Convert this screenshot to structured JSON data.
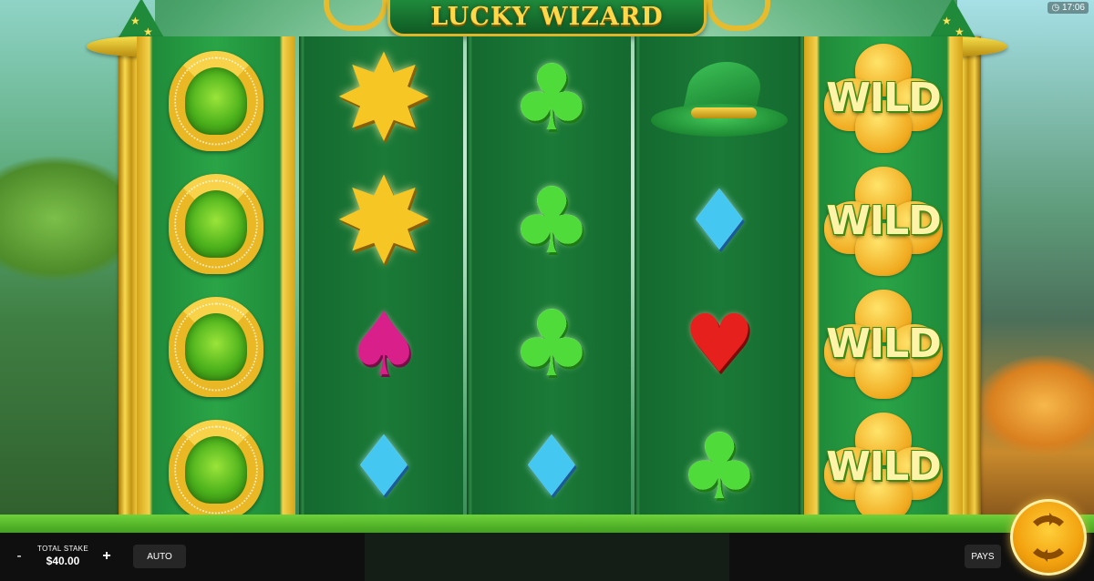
{
  "game": {
    "title": "LUCKY WIZARD",
    "clock": "17:06"
  },
  "reels": [
    {
      "name": "reel-1",
      "symbols": [
        "horseshoe",
        "horseshoe",
        "horseshoe",
        "horseshoe"
      ]
    },
    {
      "name": "reel-2",
      "symbols": [
        "gold-star",
        "gold-star",
        "spade",
        "diamond"
      ]
    },
    {
      "name": "reel-3",
      "symbols": [
        "club",
        "club",
        "club",
        "diamond"
      ]
    },
    {
      "name": "reel-4",
      "symbols": [
        "wizard-hat",
        "diamond",
        "heart",
        "club"
      ]
    },
    {
      "name": "reel-5",
      "symbols": [
        "wild",
        "wild",
        "wild",
        "wild"
      ]
    }
  ],
  "wild_label": "WILD",
  "controls": {
    "minus_label": "-",
    "plus_label": "+",
    "stake_label": "TOTAL STAKE",
    "stake_value": "$40.00",
    "auto_label": "AUTO",
    "pays_label": "PAYS",
    "spin_icon": "refresh-arrows-icon"
  },
  "colors": {
    "reel_green": "#1b7a37",
    "gold": "#e9b824",
    "club": "#4fdc3a",
    "spade": "#d81f8a",
    "heart": "#e5201d",
    "diamond": "#44c8f2",
    "bar_bg": "#0f0f0f",
    "spin_button": "#f2a10e"
  }
}
